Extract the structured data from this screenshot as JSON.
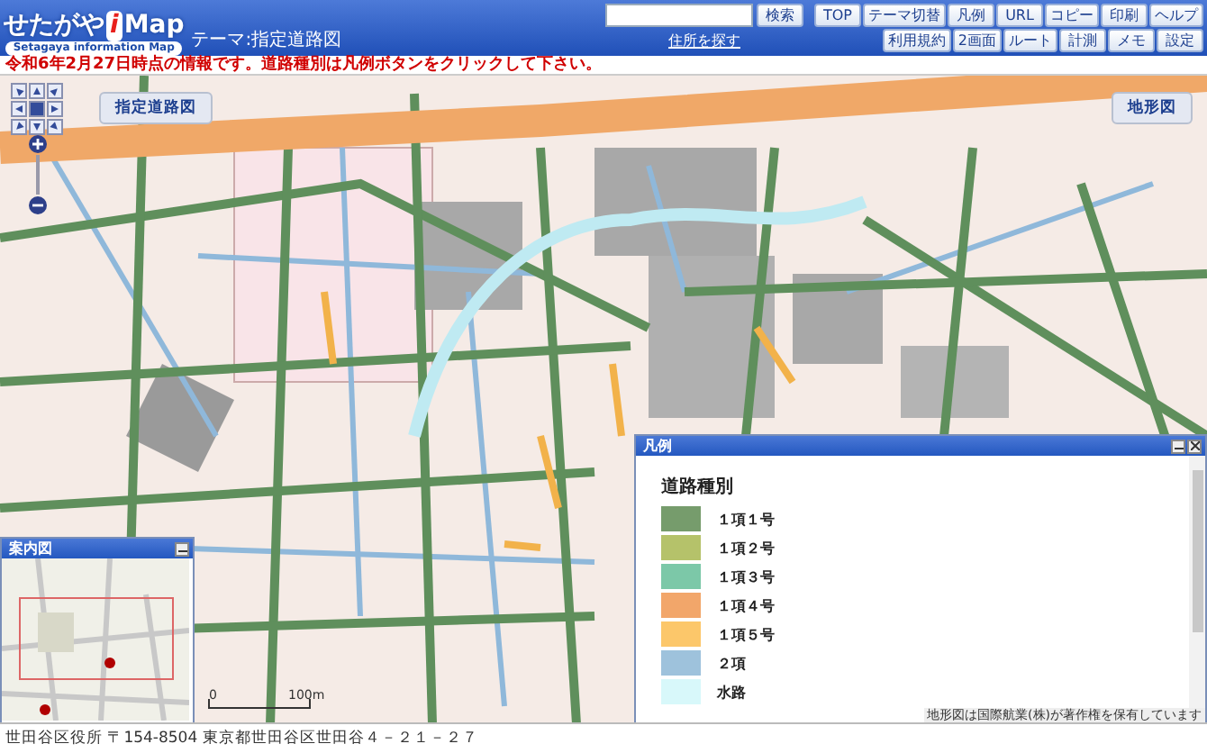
{
  "header": {
    "logo": {
      "main": "せたがや",
      "accent": "i",
      "suffix": "Map",
      "subtitle": "Setagaya information Map"
    },
    "theme": "テーマ:指定道路図",
    "search": {
      "button": "検索",
      "link": "住所を探す"
    },
    "toolbar": [
      [
        "TOP",
        "テーマ切替",
        "凡例",
        "URL",
        "コピー",
        "印刷",
        "ヘルプ"
      ],
      [
        "利用規約",
        "2画面",
        "ルート",
        "計測",
        "メモ",
        "設定"
      ]
    ]
  },
  "notice": "令和6年2月27日時点の情報です。道路種別は凡例ボタンをクリックして下さい。",
  "map": {
    "layer_button": "指定道路図",
    "terrain_button": "地形図",
    "scale": {
      "start": "0",
      "end": "100m"
    }
  },
  "guide_map": {
    "title": "案内図"
  },
  "legend": {
    "title": "凡例",
    "heading": "道路種別",
    "items": [
      {
        "label": "１項１号",
        "color": "#769c6c"
      },
      {
        "label": "１項２号",
        "color": "#b5c26a"
      },
      {
        "label": "１項３号",
        "color": "#7cc8a8"
      },
      {
        "label": "１項４号",
        "color": "#f2a66a"
      },
      {
        "label": "１項５号",
        "color": "#fcc76a"
      },
      {
        "label": "２項",
        "color": "#9ec2dc"
      },
      {
        "label": "水路",
        "color": "#d8f8fa"
      }
    ],
    "copyright": "地形図は国際航業(株)が著作権を保有しています"
  },
  "footer": "世田谷区役所 〒154-8504 東京都世田谷区世田谷４－２１－２７"
}
